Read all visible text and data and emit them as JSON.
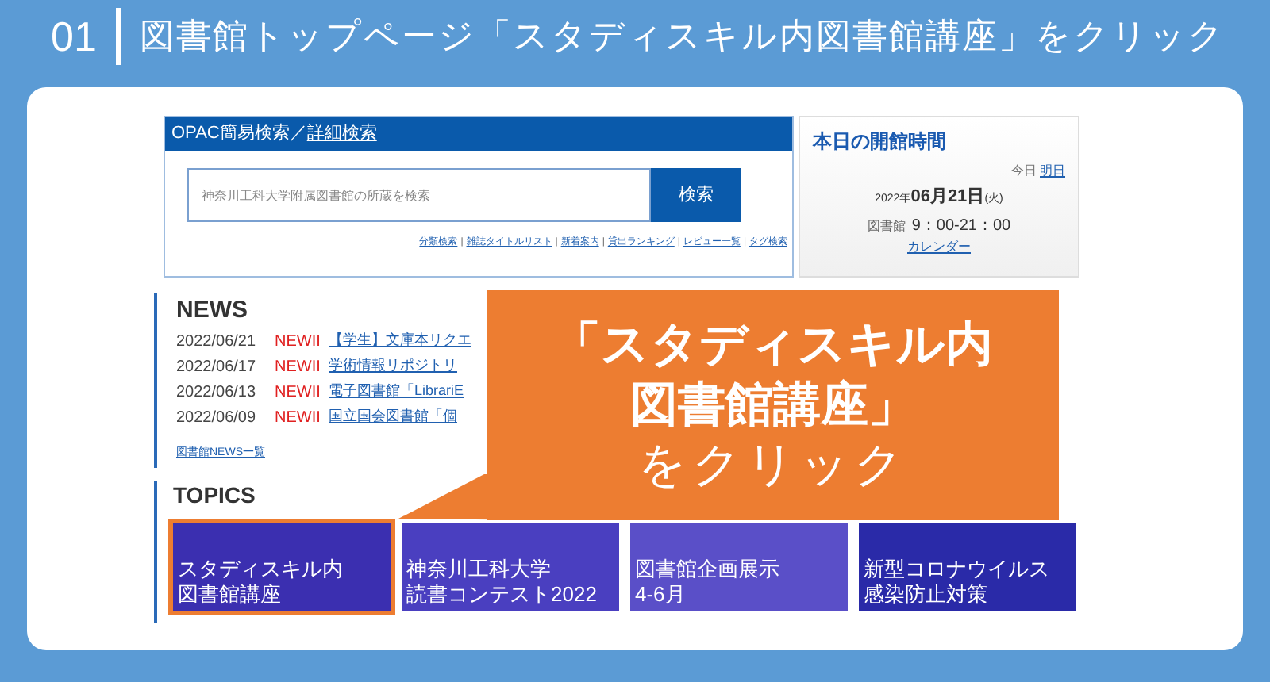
{
  "header": {
    "step": "01",
    "title": "図書館トップページ「スタディスキル内図書館講座」をクリック"
  },
  "opac": {
    "title": "OPAC簡易検索",
    "title_separator": "／",
    "title_link": "詳細検索",
    "placeholder": "神奈川工科大学附属図書館の所蔵を検索",
    "button": "検索",
    "separator": "|",
    "links": [
      "分類検索",
      "雑誌タイトルリスト",
      "新着案内",
      "貸出ランキング",
      "レビュー一覧",
      "タグ検索"
    ]
  },
  "hours": {
    "title": "本日の開館時間",
    "day_tabs": [
      {
        "label": "今日",
        "selected": true
      },
      {
        "label": "明日",
        "selected": false
      }
    ],
    "date_year": "2022年",
    "date_main": "06月21日",
    "date_weekday": "(火)",
    "place": "図書館",
    "time": "9：00-21：00",
    "calendar_link": "カレンダー"
  },
  "news": {
    "title": "NEWS",
    "items": [
      {
        "date": "2022/06/21",
        "badge": "NEWII",
        "text": "【学生】文庫本リクエ"
      },
      {
        "date": "2022/06/17",
        "badge": "NEWII",
        "text": "学術情報リポジトリ"
      },
      {
        "date": "2022/06/13",
        "badge": "NEWII",
        "text": "電子図書館「LibrariE"
      },
      {
        "date": "2022/06/09",
        "badge": "NEWII",
        "text": "国立国会図書館「個"
      }
    ],
    "more_link": "図書館NEWS一覧"
  },
  "topics": {
    "title": "TOPICS",
    "items": [
      {
        "lines": [
          "スタディスキル内",
          "図書館講座"
        ],
        "highlighted": true
      },
      {
        "lines": [
          "神奈川工科大学",
          "読書コンテスト2022"
        ],
        "highlighted": false
      },
      {
        "lines": [
          "図書館企画展示",
          "4-6月"
        ],
        "highlighted": false
      },
      {
        "lines": [
          "新型コロナウイルス",
          "感染防止対策"
        ],
        "highlighted": false
      }
    ]
  },
  "callout": {
    "lines": [
      {
        "text": "「スタディスキル内",
        "bold": true
      },
      {
        "text": "図書館講座」",
        "bold": true
      },
      {
        "text": "をクリック",
        "bold": false
      }
    ]
  }
}
